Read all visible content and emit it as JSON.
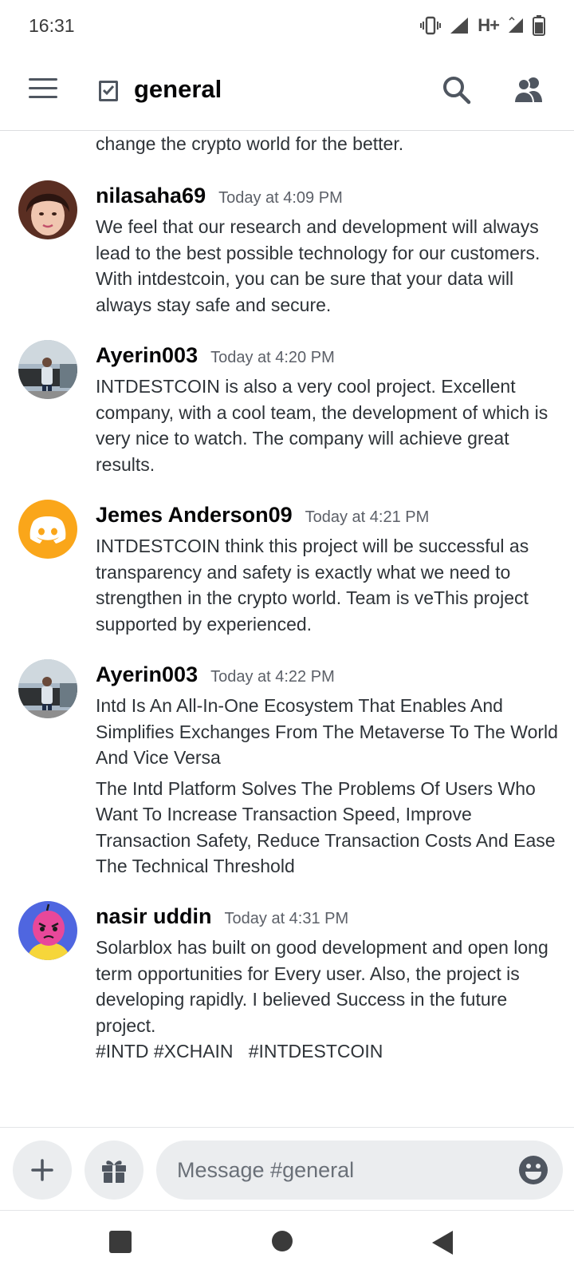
{
  "status_bar": {
    "time": "16:31",
    "network": "H+",
    "icons": [
      "vibrate-icon",
      "signal-icon",
      "signal-icon",
      "battery-icon"
    ]
  },
  "header": {
    "channel_name": "general",
    "icons": [
      "menu-icon",
      "channel-icon",
      "search-icon",
      "members-icon"
    ]
  },
  "messages": {
    "continuation_text": "change the crypto world for the better.",
    "items": [
      {
        "author": "nilasaha69",
        "timestamp": "Today at 4:09 PM",
        "paragraphs": [
          "We feel that our research and development will always lead to the best possible technology for our customers. With intdestcoin, you can be sure that your data will always stay safe and secure."
        ]
      },
      {
        "author": "Ayerin003",
        "timestamp": "Today at 4:20 PM",
        "paragraphs": [
          "INTDESTCOIN is also a very cool project.  Excellent company, with a cool team, the development of which is very nice to watch. The company will achieve great results."
        ]
      },
      {
        "author": "Jemes Anderson09",
        "timestamp": "Today at 4:21 PM",
        "avatar_color": "#faa61a",
        "paragraphs": [
          "INTDESTCOIN think this project will be successful as transparency and safety is exactly what we need to strengthen in the crypto world. Team is veThis project supported by experienced."
        ]
      },
      {
        "author": "Ayerin003",
        "timestamp": "Today at 4:22 PM",
        "paragraphs": [
          "Intd Is An All-In-One Ecosystem That Enables And Simplifies Exchanges From The Metaverse To The World And Vice Versa",
          "The Intd Platform Solves The Problems Of Users Who Want To Increase Transaction Speed, Improve Transaction Safety, Reduce Transaction Costs And Ease The Technical Threshold"
        ]
      },
      {
        "author": "nasir uddin",
        "timestamp": "Today at 4:31 PM",
        "paragraphs": [
          "Solarblox has built on good development and open long term opportunities for Every user. Also, the project is developing rapidly. I believed Success in the future  project.",
          "#INTD #XCHAIN   #INTDESTCOIN"
        ]
      }
    ]
  },
  "composer": {
    "placeholder": "Message #general",
    "icons": [
      "plus-icon",
      "gift-icon",
      "emoji-icon"
    ]
  },
  "nav_bar": {
    "icons": [
      "recents-icon",
      "home-icon",
      "back-icon"
    ]
  },
  "colors": {
    "accent_orange": "#faa61a",
    "text": "#2e3338",
    "muted": "#5c6068",
    "input_bg": "#ebedef"
  }
}
